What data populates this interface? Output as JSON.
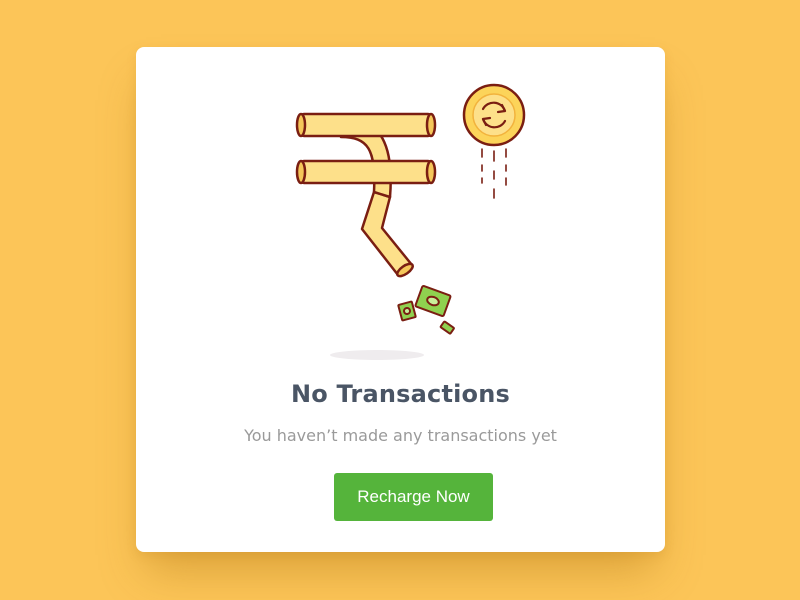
{
  "empty_state": {
    "title": "No Transactions",
    "subtitle": "You haven’t made any transactions yet",
    "cta_label": "Recharge Now"
  },
  "colors": {
    "background": "#fcc558",
    "card": "#ffffff",
    "title": "#4a5565",
    "subtitle": "#9a9a9a",
    "cta": "#55b43b",
    "illustration_fill": "#fde08a",
    "illustration_stroke": "#7a1e12",
    "banknote": "#8fd14f"
  },
  "icons": {
    "illustration": "rupee-symbol-icon",
    "coin": "refresh-coin-icon",
    "notes": "banknote-icon"
  }
}
